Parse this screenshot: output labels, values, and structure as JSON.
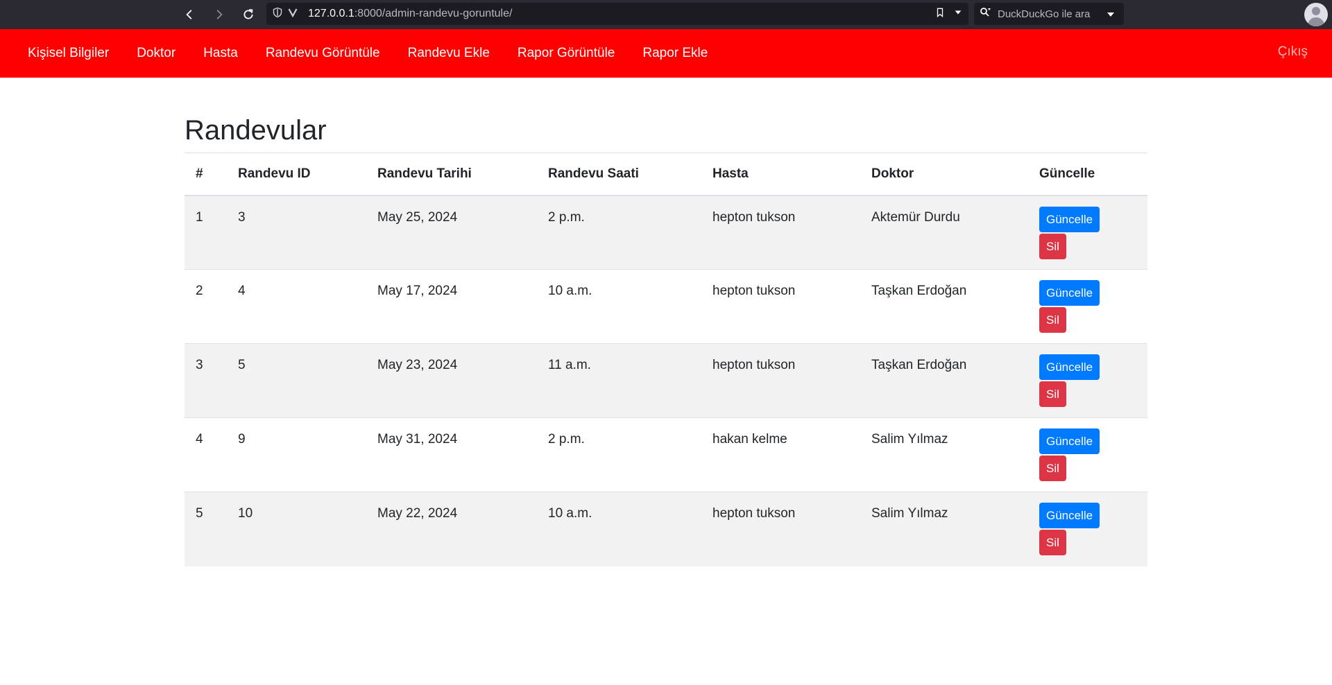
{
  "browser": {
    "url_host": "127.0.0.1",
    "url_path": ":8000/admin-randevu-goruntule/",
    "search_placeholder": "DuckDuckGo ile ara"
  },
  "nav": {
    "items": [
      {
        "label": "Kişisel Bilgiler"
      },
      {
        "label": "Doktor"
      },
      {
        "label": "Hasta"
      },
      {
        "label": "Randevu Görüntüle"
      },
      {
        "label": "Randevu Ekle"
      },
      {
        "label": "Rapor Görüntüle"
      },
      {
        "label": "Rapor Ekle"
      }
    ],
    "logout_label": "Çıkış",
    "background_color": "#ff0000"
  },
  "page": {
    "title": "Randevular"
  },
  "table": {
    "headers": [
      "#",
      "Randevu ID",
      "Randevu Tarihi",
      "Randevu Saati",
      "Hasta",
      "Doktor",
      "Güncelle"
    ],
    "update_label": "Güncelle",
    "delete_label": "Sil",
    "rows": [
      {
        "num": "1",
        "id": "3",
        "date": "May 25, 2024",
        "time": "2 p.m.",
        "patient": "hepton tukson",
        "doctor": "Aktemür Durdu"
      },
      {
        "num": "2",
        "id": "4",
        "date": "May 17, 2024",
        "time": "10 a.m.",
        "patient": "hepton tukson",
        "doctor": "Taşkan Erdoğan"
      },
      {
        "num": "3",
        "id": "5",
        "date": "May 23, 2024",
        "time": "11 a.m.",
        "patient": "hepton tukson",
        "doctor": "Taşkan Erdoğan"
      },
      {
        "num": "4",
        "id": "9",
        "date": "May 31, 2024",
        "time": "2 p.m.",
        "patient": "hakan kelme",
        "doctor": "Salim Yılmaz"
      },
      {
        "num": "5",
        "id": "10",
        "date": "May 22, 2024",
        "time": "10 a.m.",
        "patient": "hepton tukson",
        "doctor": "Salim Yılmaz"
      }
    ]
  },
  "colors": {
    "update_button": "#007bff",
    "delete_button": "#dc3545",
    "striped_row": "#f2f2f2"
  }
}
